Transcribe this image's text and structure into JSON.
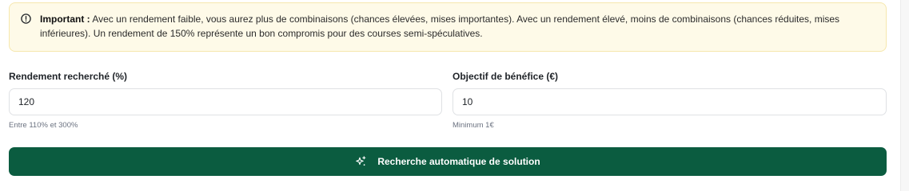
{
  "alert": {
    "icon": "alert-circle-icon",
    "title": "Important :",
    "message": "Avec un rendement faible, vous aurez plus de combinaisons (chances élevées, mises importantes). Avec un rendement élevé, moins de combinaisons (chances réduites, mises inférieures). Un rendement de 150% représente un bon compromis pour des courses semi-spéculatives.",
    "background_color": "#fefae8",
    "border_color": "#f6e7ad"
  },
  "fields": {
    "rendement": {
      "label": "Rendement recherché (%)",
      "value": "120",
      "hint": "Entre 110% et 300%"
    },
    "objectif": {
      "label": "Objectif de bénéfice (€)",
      "value": "10",
      "hint": "Minimum 1€"
    }
  },
  "action": {
    "label": "Recherche automatique de solution",
    "icon": "sparkles-icon",
    "color": "#0b5c40"
  }
}
